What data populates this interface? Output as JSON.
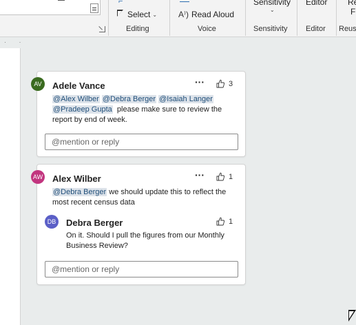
{
  "ribbon": {
    "groups": [
      {
        "label": "Editing"
      },
      {
        "label": "Voice"
      },
      {
        "label": "Sensitivity"
      },
      {
        "label": "Editor"
      },
      {
        "label": "Reus"
      }
    ],
    "select_label": "Select",
    "read_aloud_label": "Read Aloud",
    "sensitivity_label": "Sensitivity",
    "editor_label": "Editor",
    "reuse_top": "Re",
    "reuse_bottom": "Fi"
  },
  "ruler": {
    "marks": "· ·"
  },
  "comments": [
    {
      "author": "Adele Vance",
      "initials": "AV",
      "avatar_color": "#3a6b1f",
      "likes": "3",
      "mentions": [
        "@Alex Wilber",
        "@Debra Berger",
        "@Isaiah Langer",
        "@Pradeep Gupta"
      ],
      "text": "please make sure to review the report by end of week.",
      "reply_placeholder": "@mention or reply"
    },
    {
      "author": "Alex Wilber",
      "initials": "AW",
      "avatar_color": "#c2357f",
      "likes": "1",
      "mentions": [
        "@Debra Berger"
      ],
      "text": "we should update this to reflect the most recent census data",
      "reply": {
        "author": "Debra Berger",
        "initials": "DB",
        "avatar_color": "#5b5fc7",
        "likes": "1",
        "text": "On it. Should I pull the figures from our Monthly Business Review?"
      },
      "reply_placeholder": "@mention or reply"
    }
  ],
  "colors": {
    "mention_bg": "#dde3ea",
    "mention_text": "#1f4e79",
    "ribbon_bg": "#f3f3f3",
    "doc_bg": "#e9ecec"
  }
}
